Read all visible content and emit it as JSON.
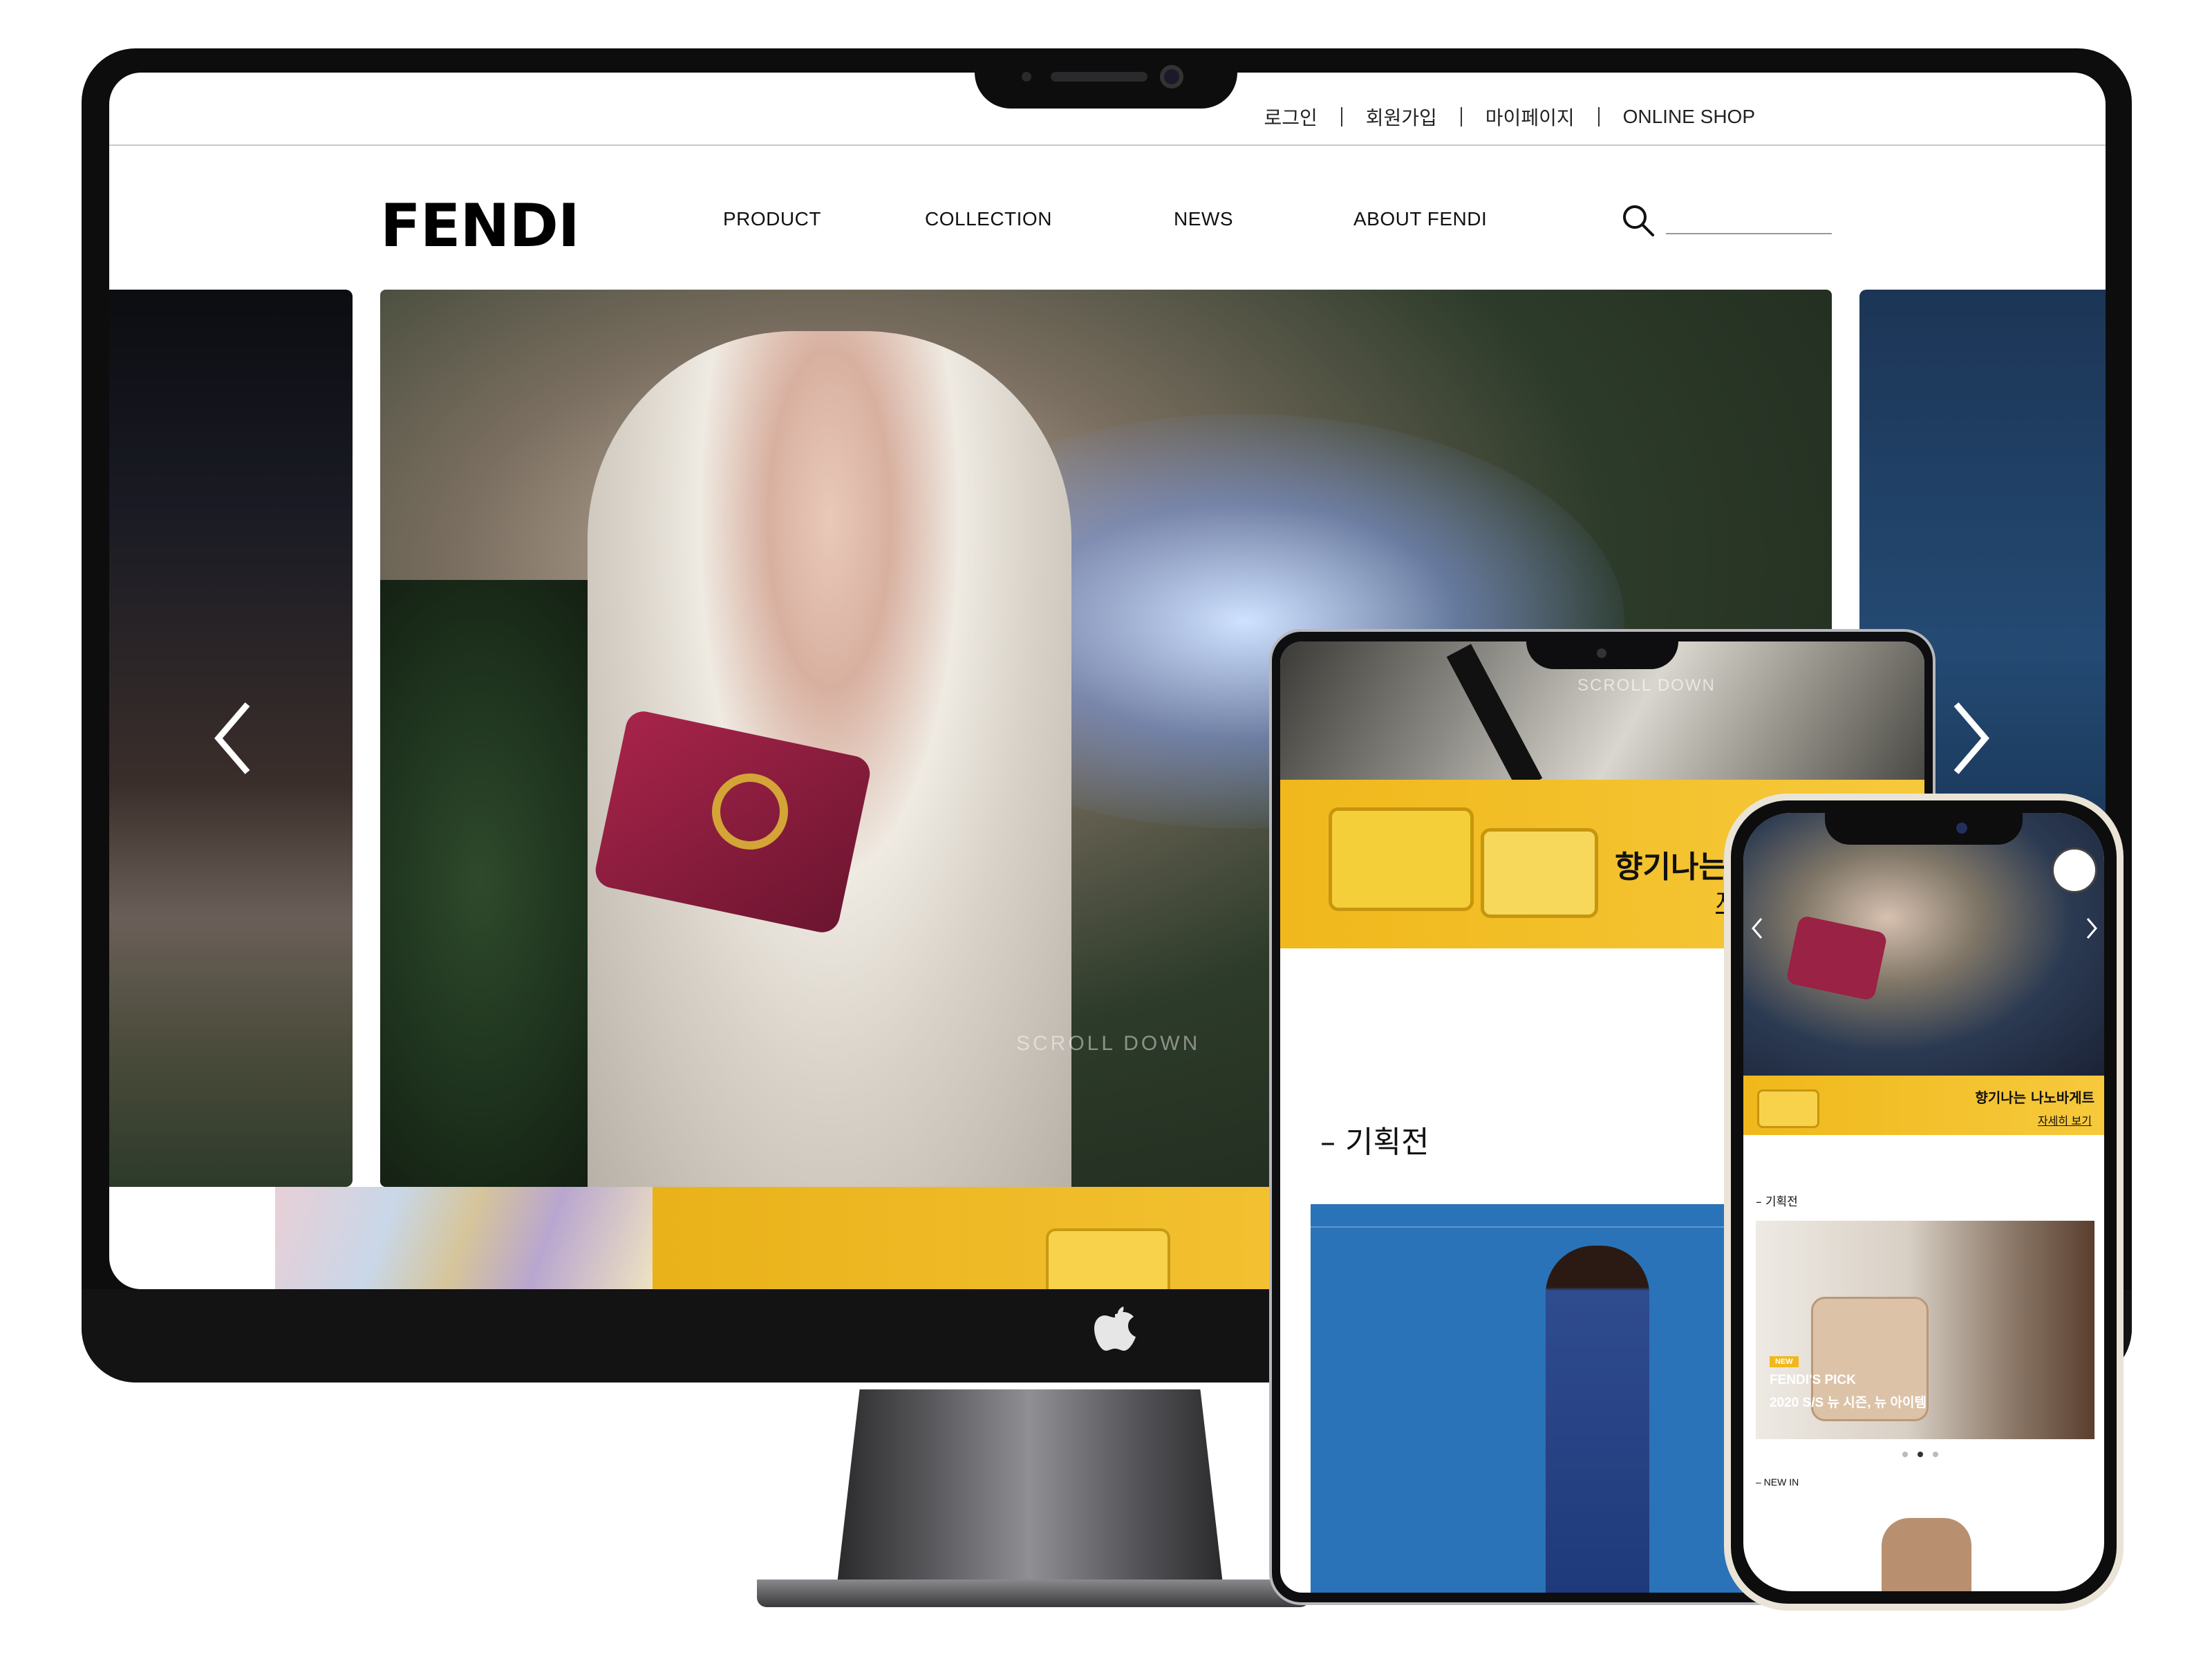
{
  "desktop": {
    "util_links": [
      "로그인",
      "회원가입",
      "마이페이지",
      "ONLINE SHOP"
    ],
    "logo": "FENDI",
    "nav": [
      "PRODUCT",
      "COLLECTION",
      "NEWS",
      "ABOUT FENDI"
    ],
    "hero_caption": "SCROLL DOWN",
    "icons": {
      "search": "search-icon",
      "prev": "chevron-left-icon",
      "next": "chevron-right-icon",
      "apple": "apple-logo-icon"
    }
  },
  "tablet": {
    "scroll_caption": "SCROLL DOWN",
    "banner_title": "향기나는",
    "banner_more": "자",
    "section_title": "– 기획전"
  },
  "phone": {
    "banner_title": "향기나는 나노바게트",
    "banner_more": "자세히 보기",
    "section_title": "– 기획전",
    "card_badge": "NEW",
    "card_title": "FENDI'S PICK",
    "card_subtitle": "2020 S/S 뉴 시즌, 뉴 아이템",
    "section_new": "– NEW IN"
  },
  "colors": {
    "accent_yellow": "#f0b81b",
    "card_blue": "#2a73b8",
    "frame": "#0d0d0e"
  }
}
